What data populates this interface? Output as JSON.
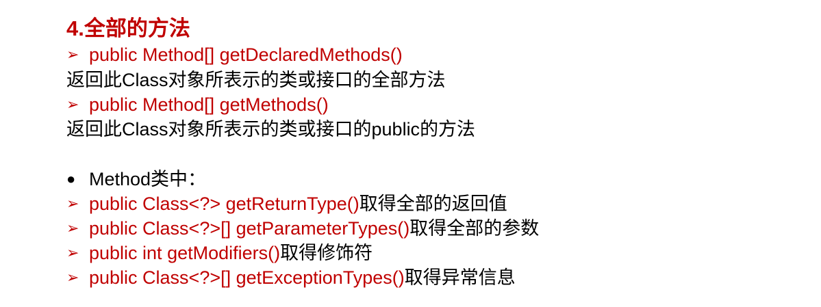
{
  "title": "4.全部的方法",
  "bullets": {
    "arrow": "➢",
    "dot": "●"
  },
  "lines": {
    "m1": "public Method[] getDeclaredMethods()",
    "d1_a": "返回此",
    "d1_b": "Class",
    "d1_c": "对象所表示的类或接口的全部方法",
    "m2": "public Method[] getMethods()",
    "d2_a": "返回此",
    "d2_b": "Class",
    "d2_c": "对象所表示的类或接口的",
    "d2_d": "public",
    "d2_e": "的方法",
    "section": "Method类中：",
    "r1_code": "public Class<?> getReturnType()",
    "r1_desc": "取得全部的返回值",
    "r2_code": "public Class<?>[] getParameterTypes()",
    "r2_desc": "取得全部的参数",
    "r3_code": "public int getModifiers()",
    "r3_desc": "取得修饰符",
    "r4_code": "public Class<?>[] getExceptionTypes()",
    "r4_desc": "取得异常信息"
  },
  "colors": {
    "accent": "#c00000",
    "text": "#000000",
    "background": "#ffffff"
  }
}
